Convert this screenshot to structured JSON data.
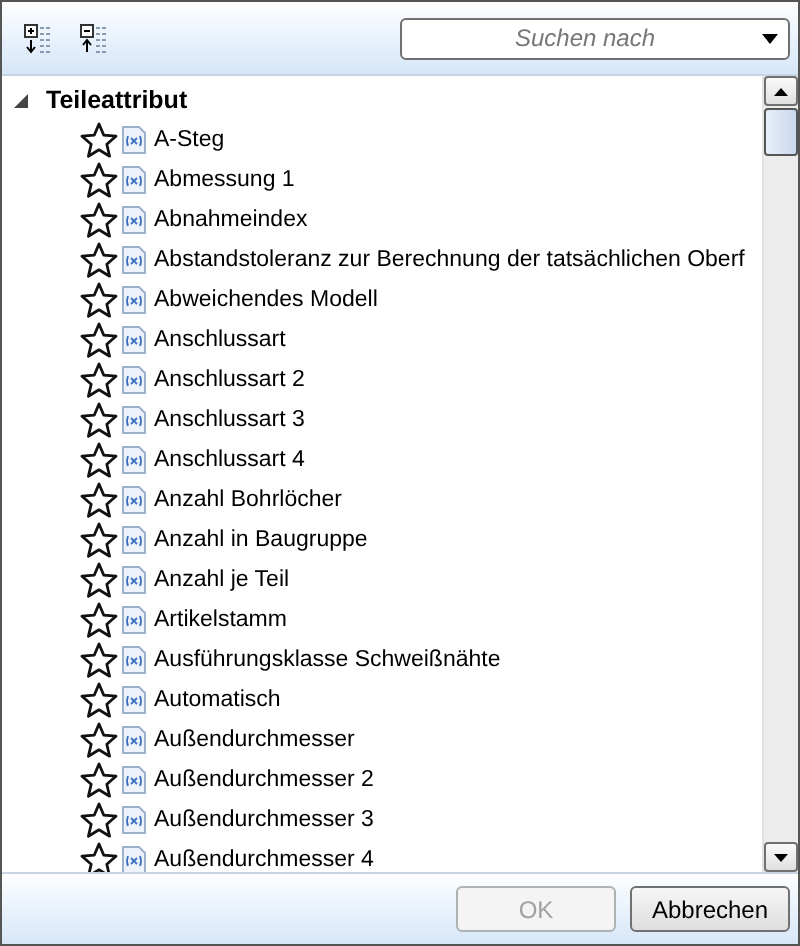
{
  "toolbar": {
    "search": {
      "placeholder": "Suchen nach"
    }
  },
  "tree": {
    "label": "Teileattribut",
    "expanded": true,
    "children": [
      {
        "label": "A-Steg",
        "favorite": false
      },
      {
        "label": "Abmessung 1",
        "favorite": false
      },
      {
        "label": "Abnahmeindex",
        "favorite": false
      },
      {
        "label": "Abstandstoleranz zur Berechnung der tatsächlichen Oberf",
        "favorite": false
      },
      {
        "label": "Abweichendes Modell",
        "favorite": false
      },
      {
        "label": "Anschlussart",
        "favorite": false
      },
      {
        "label": "Anschlussart 2",
        "favorite": false
      },
      {
        "label": "Anschlussart 3",
        "favorite": false
      },
      {
        "label": "Anschlussart 4",
        "favorite": false
      },
      {
        "label": "Anzahl Bohrlöcher",
        "favorite": false
      },
      {
        "label": "Anzahl in Baugruppe",
        "favorite": false
      },
      {
        "label": "Anzahl je Teil",
        "favorite": false
      },
      {
        "label": "Artikelstamm",
        "favorite": false
      },
      {
        "label": "Ausführungsklasse Schweißnähte",
        "favorite": false
      },
      {
        "label": "Automatisch",
        "favorite": false
      },
      {
        "label": "Außendurchmesser",
        "favorite": false
      },
      {
        "label": "Außendurchmesser 2",
        "favorite": false
      },
      {
        "label": "Außendurchmesser 3",
        "favorite": false
      },
      {
        "label": "Außendurchmesser 4",
        "favorite": false
      }
    ]
  },
  "buttons": [
    {
      "label": "OK",
      "disabled": true
    },
    {
      "label": "Abbrechen",
      "disabled": false
    }
  ]
}
